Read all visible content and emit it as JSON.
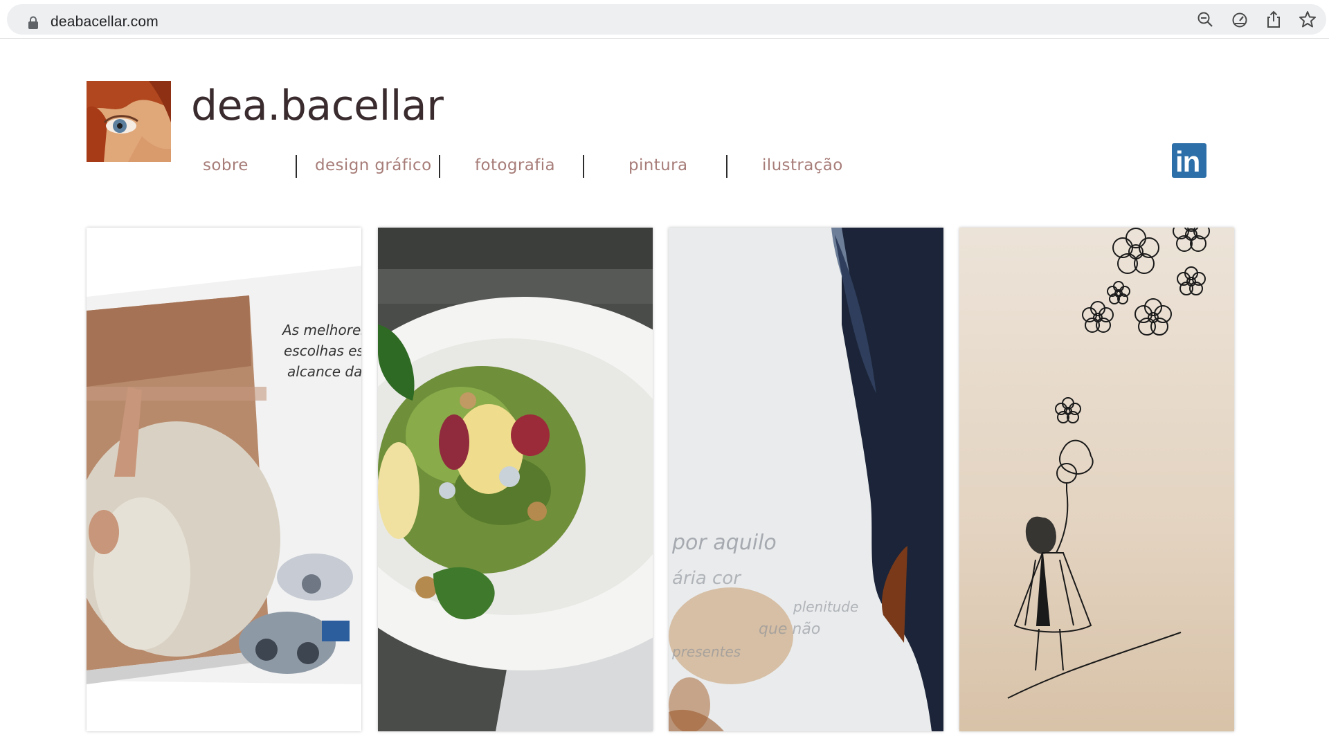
{
  "browser": {
    "url": "deabacellar.com",
    "toolbar_icons": [
      "zoom-out-icon",
      "performance-icon",
      "share-icon",
      "bookmark-star-icon"
    ]
  },
  "site": {
    "title": "dea.bacellar",
    "nav": [
      {
        "label": "sobre"
      },
      {
        "label": "design gráfico"
      },
      {
        "label": "fotografia"
      },
      {
        "label": "pintura"
      },
      {
        "label": "ilustração"
      }
    ],
    "linkedin_label": "in"
  },
  "gallery": {
    "ad_text": [
      "As melhores",
      "escolhas es",
      "alcance da"
    ],
    "painting_text": [
      "por aquilo",
      "ária cor",
      "plenitude",
      "que não",
      "presentes"
    ]
  },
  "colors": {
    "nav_text": "#a77d79",
    "title_text": "#3a2b2e",
    "linkedin_blue": "#2d6fa8"
  }
}
